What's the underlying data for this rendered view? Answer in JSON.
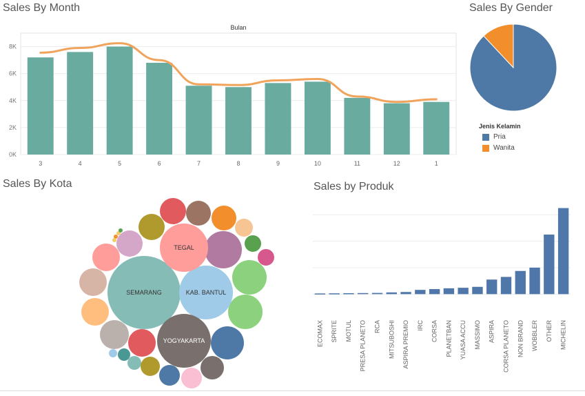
{
  "titles": {
    "month": "Sales By Month",
    "gender": "Sales By Gender",
    "kota": "Sales By Kota",
    "produk": "Sales by Produk"
  },
  "colors": {
    "bar_month": "#6aaba0",
    "line_month": "#f0a35b",
    "bar_produk": "#4f77aa",
    "pria": "#4e79a7",
    "wanita": "#f28e2b"
  },
  "chart_data": [
    {
      "type": "bar",
      "title": "Sales By Month",
      "header": "Bulan",
      "categories": [
        "3",
        "4",
        "5",
        "6",
        "7",
        "8",
        "9",
        "10",
        "11",
        "12",
        "1"
      ],
      "series": [
        {
          "values": [
            7200,
            7600,
            8000,
            6800,
            5100,
            5000,
            5300,
            5400,
            4200,
            3800,
            3900
          ]
        },
        {
          "values": [
            7550,
            7900,
            8250,
            7000,
            5200,
            5150,
            5500,
            5600,
            4300,
            3900,
            4100
          ]
        }
      ],
      "yticks": [
        "0K",
        "2K",
        "4K",
        "6K",
        "8K"
      ],
      "ylim": [
        0,
        9000
      ],
      "grid": true
    },
    {
      "type": "pie",
      "title": "Sales By Gender",
      "legend_title": "Jenis Kelamin",
      "labels": [
        "Pria",
        "Wanita"
      ],
      "values": [
        88,
        12
      ],
      "legend": "bottom-left"
    },
    {
      "type": "bubble",
      "title": "Sales By Kota",
      "labels": [
        "SEMARANG",
        "KAB. BANTUL",
        "TEGAL",
        "YOGYAKARTA"
      ],
      "values": [
        100,
        52,
        48,
        58
      ]
    },
    {
      "type": "bar",
      "title": "Sales by Produk",
      "categories": [
        "ECOMAX",
        "SPRITE",
        "MOTUL",
        "PRESA PLANETO",
        "RCA",
        "MITSUBOSHI",
        "ASPIRA PREMIO",
        "IRC",
        "CORSA",
        "PLANETBAN",
        "YUASA ACCU",
        "MASSIMO",
        "ASPIRA",
        "CORSA PLANETO",
        "NON BRAND",
        "WOBBLER",
        "OTHER",
        "MICHELIN"
      ],
      "values": [
        0.5,
        0.6,
        0.7,
        0.8,
        0.9,
        1.3,
        1.6,
        3.2,
        3.8,
        4.4,
        4.8,
        5.5,
        11,
        13,
        17.5,
        20,
        45,
        65
      ],
      "ylim": [
        -4,
        70
      ],
      "grid": true
    }
  ]
}
